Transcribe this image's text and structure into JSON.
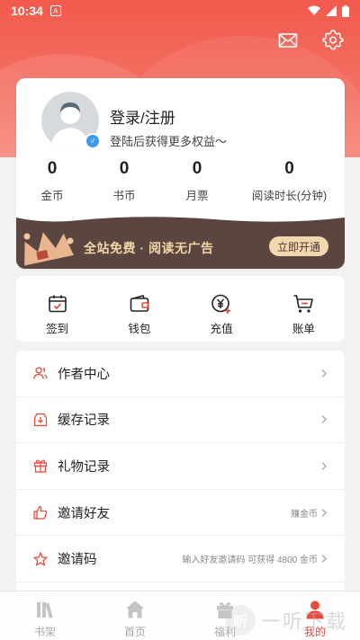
{
  "status_bar": {
    "time": "10:34",
    "notification_icon": "A"
  },
  "header": {
    "mail_icon": "mail-icon",
    "settings_icon": "gear-icon"
  },
  "profile": {
    "login_title": "登录/注册",
    "login_subtitle": "登陆后获得更多权益～",
    "gender_symbol": "♂",
    "stats": [
      {
        "value": "0",
        "label": "金币"
      },
      {
        "value": "0",
        "label": "书币"
      },
      {
        "value": "0",
        "label": "月票"
      },
      {
        "value": "0",
        "label": "阅读时长(分钟)"
      }
    ]
  },
  "vip_banner": {
    "text": "全站免费 · 阅读无广告",
    "button": "立即开通"
  },
  "quick_actions": [
    {
      "label": "签到",
      "icon": "calendar-check-icon"
    },
    {
      "label": "钱包",
      "icon": "wallet-icon"
    },
    {
      "label": "充值",
      "icon": "yuan-recharge-icon"
    },
    {
      "label": "账单",
      "icon": "cart-bill-icon"
    }
  ],
  "menu": [
    {
      "label": "作者中心",
      "icon": "author-icon",
      "hint": ""
    },
    {
      "label": "缓存记录",
      "icon": "download-icon",
      "hint": ""
    },
    {
      "label": "礼物记录",
      "icon": "gift-icon",
      "hint": ""
    },
    {
      "label": "邀请好友",
      "icon": "thumbs-up-icon",
      "hint": "赚金币"
    },
    {
      "label": "邀请码",
      "icon": "star-icon",
      "hint": "输入好友邀请码 可获得 4800 金币"
    }
  ],
  "tabs": [
    {
      "label": "书架",
      "icon": "bookshelf-icon",
      "active": false
    },
    {
      "label": "首页",
      "icon": "home-icon",
      "active": false
    },
    {
      "label": "福利",
      "icon": "gift-icon",
      "active": false
    },
    {
      "label": "我的",
      "icon": "user-icon",
      "active": true
    }
  ],
  "watermark": {
    "logo": "听",
    "text": "一听下载"
  },
  "colors": {
    "accent": "#e84a3c",
    "header": "#f25a4c",
    "vip_bg": "#5a4540",
    "vip_gold": "#f3d6a8"
  }
}
